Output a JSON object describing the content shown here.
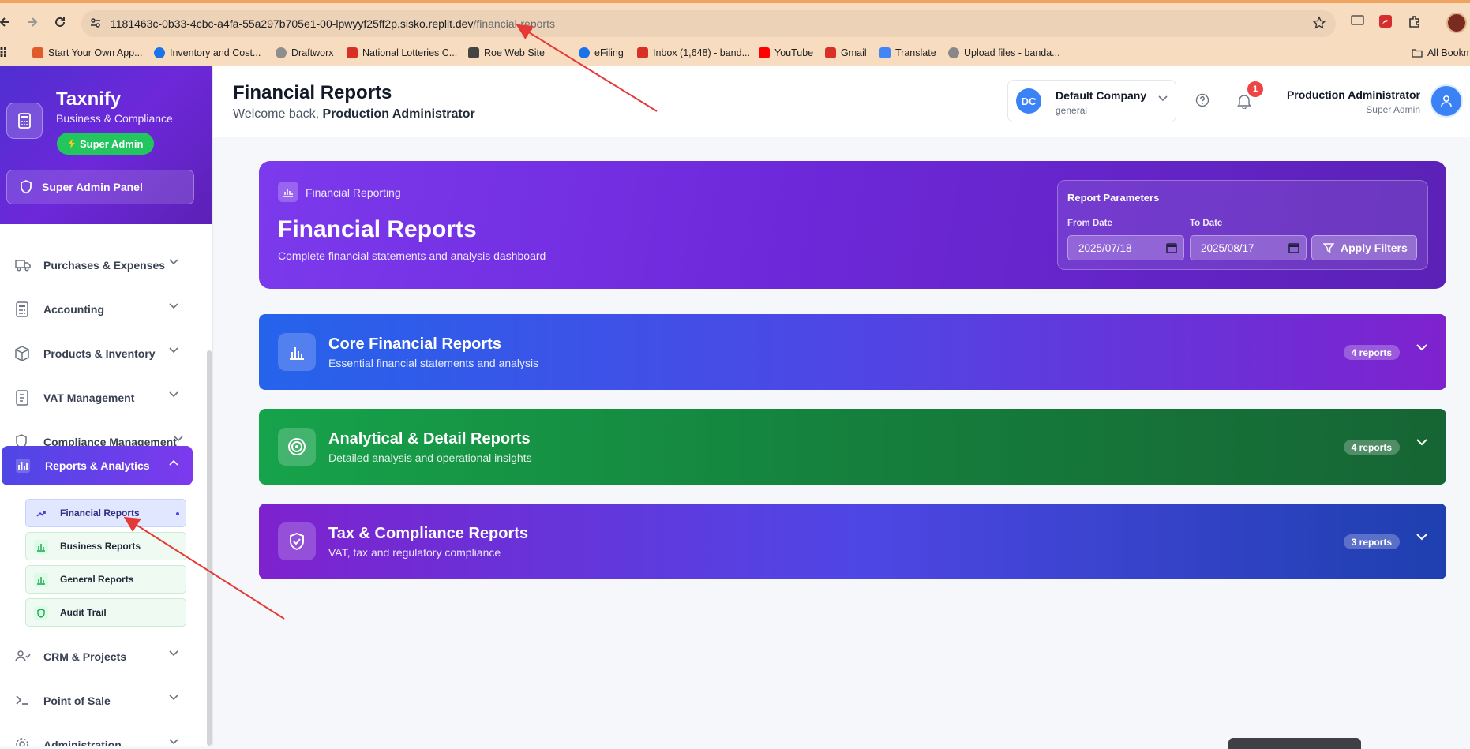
{
  "browser": {
    "url_host": "1181463c-0b33-4cbc-a4fa-55a297b705e1-00-lpwyyf25ff2p.sisko.replit.dev",
    "url_path": "/financial-reports"
  },
  "bookmarks": [
    {
      "label": "Start Your Own App...",
      "color": "#e05a2b"
    },
    {
      "label": "Inventory and Cost...",
      "color": "#1a73e8"
    },
    {
      "label": "Draftworx",
      "color": "#8e8e8e"
    },
    {
      "label": "National Lotteries C...",
      "color": "#d93025"
    },
    {
      "label": "Roe Web Site",
      "color": "#444444"
    },
    {
      "label": "eFiling",
      "color": "#1a73e8"
    },
    {
      "label": "Inbox (1,648) - band...",
      "color": "#d93025"
    },
    {
      "label": "YouTube",
      "color": "#ff0000"
    },
    {
      "label": "Gmail",
      "color": "#d93025"
    },
    {
      "label": "Translate",
      "color": "#4285f4"
    },
    {
      "label": "Upload files - banda...",
      "color": "#888888"
    }
  ],
  "bookmarks_right": "All Bookm",
  "sidebar": {
    "brand_name": "Taxnify",
    "brand_sub": "Business & Compliance",
    "super_badge": "Super Admin",
    "admin_panel": "Super Admin Panel",
    "items": [
      {
        "label": "Purchases & Expenses",
        "icon": "truck-icon"
      },
      {
        "label": "Accounting",
        "icon": "calculator-icon"
      },
      {
        "label": "Products & Inventory",
        "icon": "box-icon"
      },
      {
        "label": "VAT Management",
        "icon": "receipt-icon"
      },
      {
        "label": "Compliance Management",
        "icon": "shield-icon"
      },
      {
        "label": "Reports & Analytics",
        "icon": "bar-chart-icon"
      },
      {
        "label": "CRM & Projects",
        "icon": "users-icon"
      },
      {
        "label": "Point of Sale",
        "icon": "terminal-icon"
      },
      {
        "label": "Administration",
        "icon": "settings-icon"
      }
    ],
    "sub_items": [
      {
        "label": "Financial Reports"
      },
      {
        "label": "Business Reports"
      },
      {
        "label": "General Reports"
      },
      {
        "label": "Audit Trail"
      }
    ]
  },
  "header": {
    "title": "Financial Reports",
    "welcome_prefix": "Welcome back,",
    "welcome_name": "Production Administrator",
    "company_initials": "DC",
    "company_name": "Default Company",
    "company_type": "general",
    "notification_count": "1",
    "user_name": "Production Administrator",
    "user_role": "Super Admin"
  },
  "hero": {
    "tag": "Financial Reporting",
    "title": "Financial Reports",
    "subtitle": "Complete financial statements and analysis dashboard",
    "params_title": "Report Parameters",
    "from_label": "From Date",
    "from_value": "2025/07/18",
    "to_label": "To Date",
    "to_value": "2025/08/17",
    "apply_label": "Apply Filters"
  },
  "sections": [
    {
      "title": "Core Financial Reports",
      "subtitle": "Essential financial statements and analysis",
      "count": "4 reports"
    },
    {
      "title": "Analytical & Detail Reports",
      "subtitle": "Detailed analysis and operational insights",
      "count": "4 reports"
    },
    {
      "title": "Tax & Compliance Reports",
      "subtitle": "VAT, tax and regulatory compliance",
      "count": "3 reports"
    }
  ],
  "colors": {
    "accent": "#6d28d9",
    "brand": "#4f46e5",
    "success": "#22c55e",
    "annotation": "#e53935"
  }
}
